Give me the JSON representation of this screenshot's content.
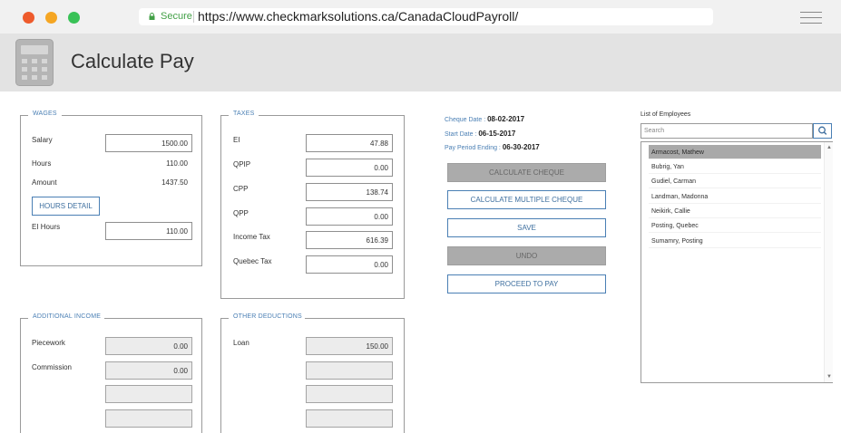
{
  "browser": {
    "secure_label": "Secure",
    "url": "https://www.checkmarksolutions.ca/CanadaCloudPayroll/"
  },
  "header": {
    "title": "Calculate Pay"
  },
  "wages": {
    "legend": "WAGES",
    "salary_label": "Salary",
    "salary_value": "1500.00",
    "hours_label": "Hours",
    "hours_value": "110.00",
    "amount_label": "Amount",
    "amount_value": "1437.50",
    "hours_detail_button": "HOURS DETAIL",
    "ei_hours_label": "EI Hours",
    "ei_hours_value": "110.00"
  },
  "taxes": {
    "legend": "TAXES",
    "rows": [
      {
        "label": "EI",
        "value": "47.88"
      },
      {
        "label": "QPIP",
        "value": "0.00"
      },
      {
        "label": "CPP",
        "value": "138.74"
      },
      {
        "label": "QPP",
        "value": "0.00"
      },
      {
        "label": "Income Tax",
        "value": "616.39"
      },
      {
        "label": "Quebec Tax",
        "value": "0.00"
      }
    ]
  },
  "additional_income": {
    "legend": "ADDITIONAL INCOME",
    "rows": [
      {
        "label": "Piecework",
        "value": "0.00"
      },
      {
        "label": "Commission",
        "value": "0.00"
      },
      {
        "label": "",
        "value": ""
      },
      {
        "label": "",
        "value": ""
      }
    ]
  },
  "other_deductions": {
    "legend": "OTHER DEDUCTIONS",
    "rows": [
      {
        "label": "Loan",
        "value": "150.00"
      },
      {
        "label": "",
        "value": ""
      },
      {
        "label": "",
        "value": ""
      },
      {
        "label": "",
        "value": ""
      }
    ]
  },
  "cheque_info": {
    "cheque_date_label": "Cheque Date : ",
    "cheque_date": "08-02-2017",
    "start_date_label": "Start Date : ",
    "start_date": "06-15-2017",
    "pay_period_label": "Pay Period Ending : ",
    "pay_period_ending": "06-30-2017"
  },
  "actions": {
    "calculate_cheque": "CALCULATE CHEQUE",
    "calculate_multiple": "CALCULATE MULTIPLE CHEQUE",
    "save": "SAVE",
    "undo": "UNDO",
    "proceed": "PROCEED TO PAY"
  },
  "employees": {
    "title": "List of Employees",
    "search_placeholder": "Search",
    "items": [
      "Armacost, Mathew",
      "Bubrig, Yan",
      "Gudiel, Carman",
      "Landman, Madonna",
      "Neikirk, Callie",
      "Posting, Quebec",
      "Sumamry, Posting"
    ],
    "selected_index": 0
  },
  "colors": {
    "accent": "#4a7fb4",
    "header_bg": "#e3e3e3",
    "disabled_button": "#ababab",
    "selected_row": "#a9a9a9"
  }
}
